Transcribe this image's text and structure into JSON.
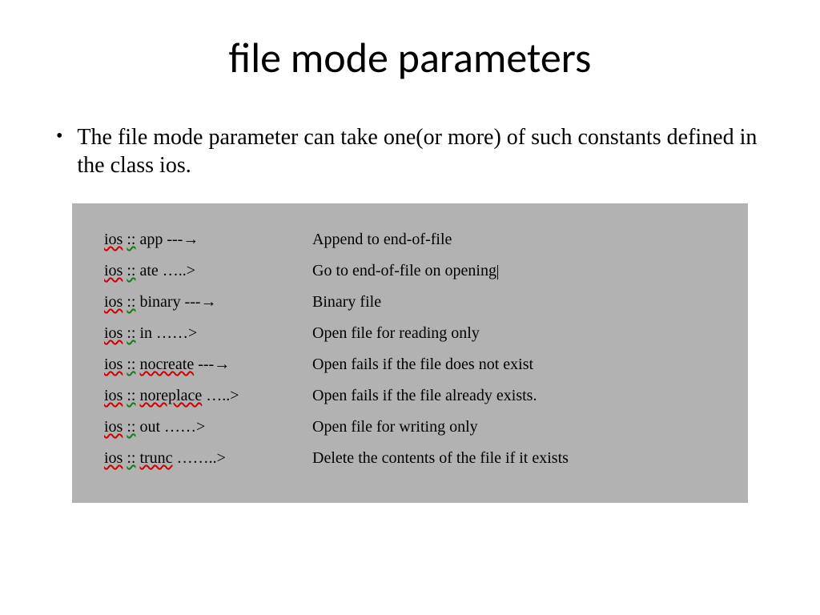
{
  "title": "file mode parameters",
  "bullet": "The file mode parameter can take one(or more) of such constants defined in the class ios.",
  "rows": [
    {
      "prefix": "ios",
      "sep": "::",
      "name": "app",
      "connector_pre": "---",
      "connector_post": "",
      "arrow": true,
      "desc": "Append to end-of-file"
    },
    {
      "prefix": "ios",
      "sep": "::",
      "name": "ate",
      "connector_pre": "…..",
      "connector_post": ">",
      "arrow": false,
      "desc": "Go to end-of-file on opening"
    },
    {
      "prefix": "ios",
      "sep": "::",
      "name": "binary",
      "connector_pre": "---",
      "connector_post": "",
      "arrow": true,
      "desc": "Binary file"
    },
    {
      "prefix": "ios",
      "sep": "::",
      "name": "in",
      "connector_pre": "……",
      "connector_post": ">",
      "arrow": false,
      "desc": "Open file for reading only"
    },
    {
      "prefix": "ios",
      "sep": "::",
      "name": "nocreate",
      "connector_pre": "---",
      "connector_post": "",
      "arrow": true,
      "desc": "Open  fails if the file does not exist"
    },
    {
      "prefix": "ios",
      "sep": "::",
      "name": "noreplace",
      "connector_pre": "…..",
      "connector_post": ">",
      "arrow": false,
      "desc": "Open fails if the file already exists."
    },
    {
      "prefix": "ios",
      "sep": "::",
      "name": "out",
      "connector_pre": "……",
      "connector_post": ">",
      "arrow": false,
      "desc": "Open file for writing only"
    },
    {
      "prefix": "ios",
      "sep": "::",
      "name": "trunc",
      "connector_pre": "……..",
      "connector_post": ">",
      "arrow": false,
      "desc": "Delete the contents of the file if it exists"
    }
  ],
  "cursor_row": 1,
  "underline_names": [
    "nocreate",
    "noreplace",
    "trunc"
  ]
}
